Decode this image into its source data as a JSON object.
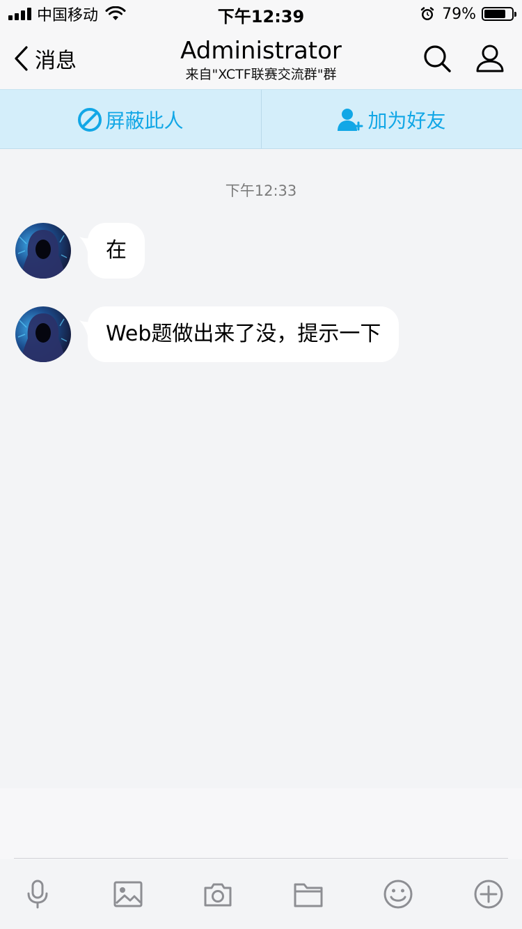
{
  "status_bar": {
    "carrier": "中国移动",
    "time": "下午12:39",
    "battery_percent_label": "79%",
    "battery_level": 0.79
  },
  "nav": {
    "back_label": "消息",
    "title": "Administrator",
    "subtitle": "来自\"XCTF联赛交流群\"群"
  },
  "actions": {
    "block_label": "屏蔽此人",
    "add_friend_label": "加为好友"
  },
  "chat": {
    "time_label": "下午12:33",
    "messages": [
      {
        "text": "在"
      },
      {
        "text": "Web题做出来了没，提示一下"
      }
    ]
  },
  "toolbar": {
    "icons": [
      "microphone-icon",
      "image-icon",
      "camera-icon",
      "folder-icon",
      "emoji-icon",
      "plus-icon"
    ]
  },
  "colors": {
    "accent": "#12a7e6",
    "action_bar_bg": "#d4eefa",
    "chat_bg": "#f3f4f6",
    "bubble_bg": "#ffffff"
  }
}
